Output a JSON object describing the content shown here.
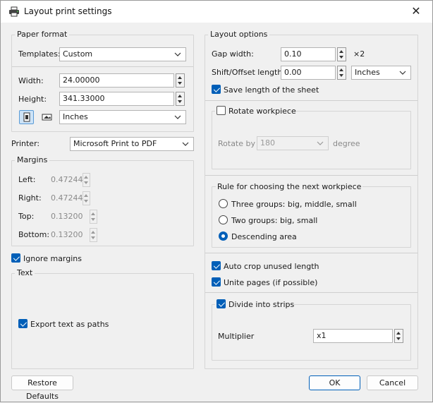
{
  "window": {
    "title": "Layout print settings",
    "icon": "printer-icon",
    "close": "✕"
  },
  "paper_format": {
    "group_label": "Paper format",
    "templates_label": "Templates:",
    "templates_value": "Custom",
    "width_label": "Width:",
    "width_value": "24.00000",
    "height_label": "Height:",
    "height_value": "341.33000",
    "units_value": "Inches"
  },
  "printer": {
    "label": "Printer:",
    "value": "Microsoft Print to PDF"
  },
  "margins": {
    "group_label": "Margins",
    "left_label": "Left:",
    "left_value": "0.47244",
    "right_label": "Right:",
    "right_value": "0.47244",
    "top_label": "Top:",
    "top_value": "0.13200",
    "bottom_label": "Bottom:",
    "bottom_value": "0.13200"
  },
  "ignore_margins": {
    "label": "Ignore margins",
    "checked": true
  },
  "text_group": {
    "label": "Text",
    "export_label": "Export text as paths",
    "export_checked": true
  },
  "layout_options": {
    "group_label": "Layout options",
    "gap_label": "Gap width:",
    "gap_value": "0.10",
    "gap_suffix": "×2",
    "shift_label": "Shift/Offset length:",
    "shift_value": "0.00",
    "shift_units": "Inches",
    "save_length_label": "Save length of the sheet",
    "save_length_checked": true,
    "rotate_label": "Rotate workpiece",
    "rotate_checked": false,
    "rotate_by_label": "Rotate by",
    "rotate_by_value": "180",
    "rotate_unit": "degree",
    "rule_label": "Rule for choosing the next workpiece",
    "rule_options": [
      "Three groups: big, middle, small",
      "Two groups: big, small",
      "Descending area"
    ],
    "rule_selected": 2,
    "auto_crop_label": "Auto crop unused length",
    "auto_crop_checked": true,
    "unite_label": "Unite pages (if possible)",
    "unite_checked": true,
    "divide_label": "Divide into strips",
    "divide_checked": true,
    "multiplier_label": "Multiplier",
    "multiplier_value": "x1"
  },
  "buttons": {
    "restore": "Restore Defaults",
    "ok": "OK",
    "cancel": "Cancel"
  },
  "colors": {
    "accent": "#005fb8",
    "background": "#f0f0f0"
  }
}
